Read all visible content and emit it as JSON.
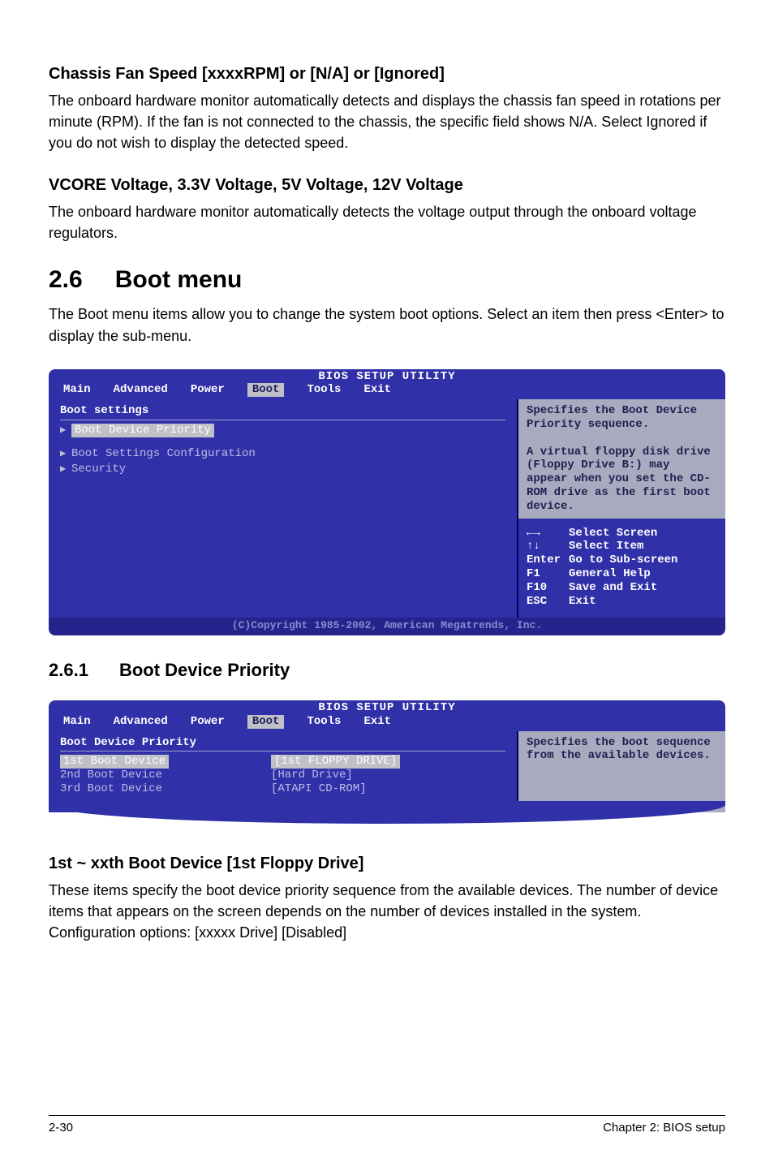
{
  "sections": {
    "chassis": {
      "heading": "Chassis Fan Speed [xxxxRPM] or [N/A] or [Ignored]",
      "body": "The onboard hardware monitor automatically detects and displays the chassis fan speed in rotations per minute (RPM). If the fan is not connected to the chassis, the specific field shows N/A. Select Ignored if you do not wish to display the detected speed."
    },
    "vcore": {
      "heading": "VCORE Voltage, 3.3V Voltage, 5V Voltage, 12V Voltage",
      "body": "The onboard hardware monitor automatically detects the voltage output through the onboard voltage regulators."
    },
    "boot_chapter": {
      "num": "2.6",
      "title": "Boot menu",
      "body": "The Boot menu items allow you to change the system boot options. Select an item then press <Enter> to display the sub-menu."
    },
    "boot_priority": {
      "num": "2.6.1",
      "title": "Boot Device Priority"
    },
    "first_boot": {
      "heading": "1st ~ xxth Boot Device [1st Floppy Drive]",
      "body": "These items specify the boot device priority sequence from the available devices. The number of device items that appears on the screen depends on the number of devices installed in the system. Configuration options: [xxxxx Drive] [Disabled]"
    }
  },
  "bios1": {
    "header": "BIOS SETUP UTILITY",
    "tabs": [
      "Main",
      "Advanced",
      "Power",
      "Boot",
      "Tools",
      "Exit"
    ],
    "active_tab": "Boot",
    "left_title": "Boot settings",
    "items": {
      "priority": "Boot Device Priority",
      "settings_cfg": "Boot Settings Configuration",
      "security": "Security"
    },
    "help_top": "Specifies the Boot Device Priority sequence.\n\nA virtual floppy disk drive (Floppy Drive B:) may appear when you set the CD-ROM drive as the first boot device.",
    "help_bottom": [
      {
        "key": "←→",
        "label": "Select Screen"
      },
      {
        "key": "↑↓",
        "label": "Select Item"
      },
      {
        "key": "Enter",
        "label": "Go to Sub-screen"
      },
      {
        "key": "F1",
        "label": "General Help"
      },
      {
        "key": "F10",
        "label": "Save and Exit"
      },
      {
        "key": "ESC",
        "label": "Exit"
      }
    ],
    "copyright": "(C)Copyright 1985-2002, American Megatrends, Inc."
  },
  "bios2": {
    "header": "BIOS SETUP UTILITY",
    "tabs": [
      "Main",
      "Advanced",
      "Power",
      "Boot",
      "Tools",
      "Exit"
    ],
    "active_tab": "Boot",
    "left_title": "Boot Device Priority",
    "rows": [
      {
        "label": "1st Boot Device",
        "value": "[1st FLOPPY DRIVE]",
        "selected": true
      },
      {
        "label": "2nd Boot Device",
        "value": "[Hard Drive]",
        "selected": false
      },
      {
        "label": "3rd Boot Device",
        "value": "[ATAPI CD-ROM]",
        "selected": false
      }
    ],
    "help_top": "Specifies the boot sequence from the available devices."
  },
  "footer": {
    "left": "2-30",
    "right": "Chapter 2: BIOS setup"
  }
}
